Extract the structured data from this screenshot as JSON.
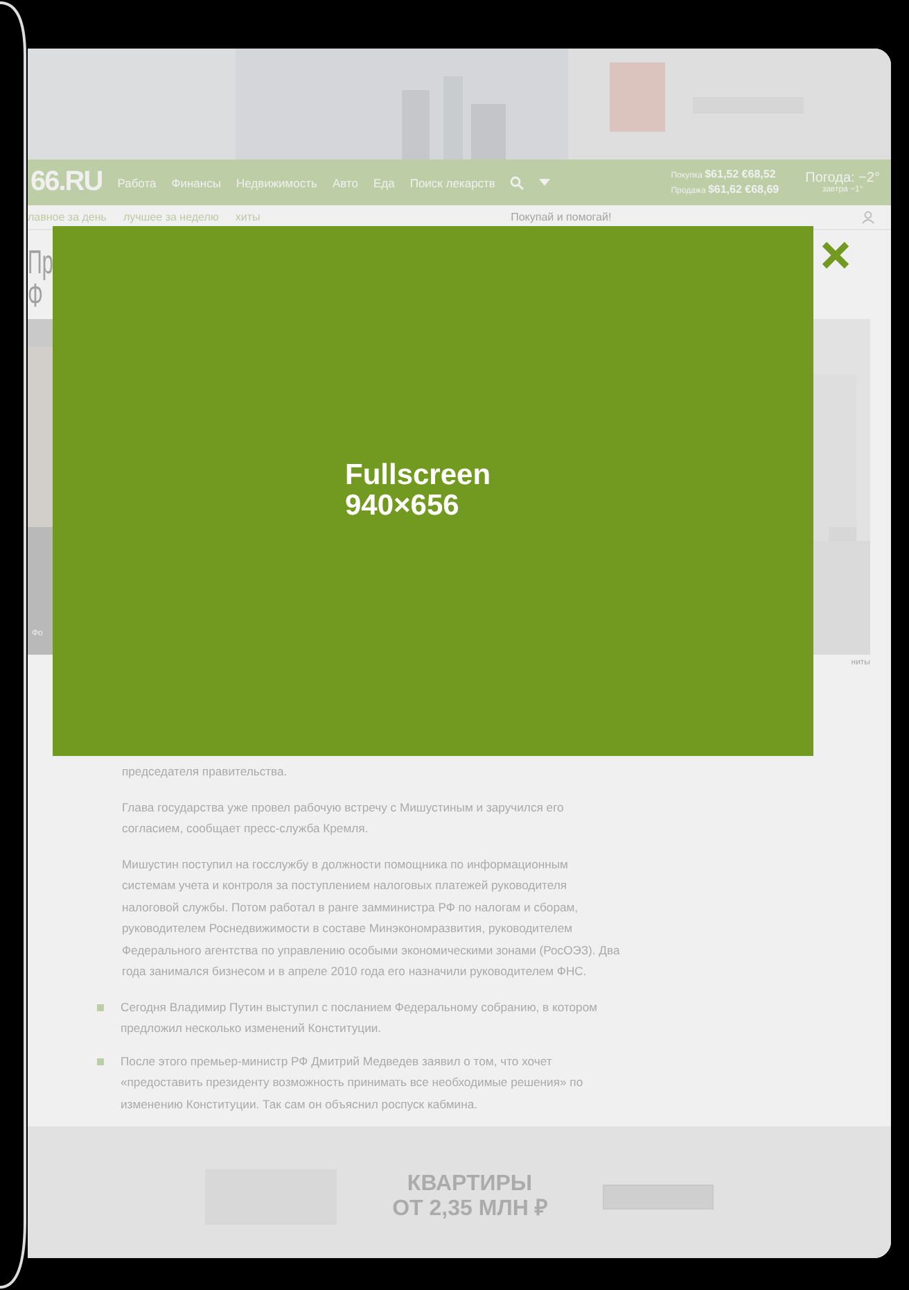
{
  "nav": {
    "logo": "66.RU",
    "items": [
      "Работа",
      "Финансы",
      "Недвижимость",
      "Авто",
      "Еда",
      "Поиск лекарств"
    ],
    "rates": [
      {
        "label": "Покупка",
        "usd": "$61,52",
        "eur": "€68,52"
      },
      {
        "label": "Продажа",
        "usd": "$61,62",
        "eur": "€68,69"
      }
    ],
    "weather": {
      "now": "Погода: −2°",
      "tomorrow": "завтра −1°"
    }
  },
  "subnav": {
    "items": [
      "лавное за день",
      "лучшее за неделю",
      "хиты"
    ],
    "promo": "Покупай и помогай!"
  },
  "article": {
    "title_lines": [
      "Пр",
      "Ф"
    ],
    "photo_caption": "Фо",
    "side_caption": "ниты",
    "paragraphs": [
      "председателя правительства.",
      "Глава государства уже провел рабочую встречу с Мишустиным и заручился его согласием, сообщает пресс-служба Кремля.",
      "Мишустин поступил на госслужбу в должности помощника по информационным системам учета и контроля за поступлением налоговых платежей руководителя налоговой службы. Потом работал в ранге замминистра РФ по налогам и сборам, руководителем Роснедвижимости в составе Минэкономразвития, руководителем Федерального агентства по управлению особыми экономическими зонами (РосОЭЗ). Два года занимался бизнесом и в апреле 2010 года его назначили руководителем ФНС."
    ],
    "bullets": [
      "Сегодня Владимир Путин выступил с посланием Федеральному собранию, в котором предложил несколько изменений Конституции.",
      "После этого премьер-министр РФ Дмитрий Медведев заявил о том, что хочет «предоставить президенту возможность принимать все необходимые решения» по изменению Конституции. Так сам он объяснил роспуск кабмина."
    ]
  },
  "ad": {
    "headline_lines": [
      "КВАРТИРЫ",
      "ОТ 2,35 МЛН ₽"
    ]
  },
  "modal": {
    "title": "Fullscreen",
    "size": "940×656"
  }
}
